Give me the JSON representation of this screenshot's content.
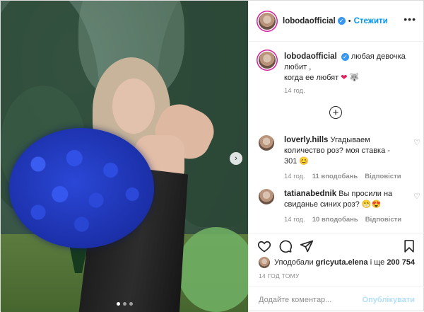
{
  "post": {
    "author": "lobodaofficial",
    "verified": true,
    "follow_label": "Стежити",
    "more_icon": "more-dots-icon"
  },
  "caption": {
    "username": "lobodaofficial",
    "line1": "любая девочка",
    "line2": "любит ,",
    "line3": "когда ее любят",
    "emoji_heart": "❤",
    "emoji_wolf": "🐺",
    "time": "14 год."
  },
  "comments": [
    {
      "username": "loverly.hills",
      "text": "Угадываем количество роз? моя ставка - 301",
      "emoji": "😊",
      "time": "14 год.",
      "likes": "11 вподобань",
      "reply": "Відповісти"
    },
    {
      "username": "tatianabednik",
      "text": "Вы просили на свиданье синих роз?",
      "emoji": "😁😍",
      "time": "14 год.",
      "likes": "10 вподобань",
      "reply": "Відповісти"
    }
  ],
  "likes": {
    "prefix": "Уподобали",
    "user": "gricyuta.elena",
    "middle": "і ще",
    "count": "200 754"
  },
  "post_time": "14 ГОД ТОМУ",
  "add_comment": {
    "placeholder": "Додайте коментар...",
    "publish_label": "Опублікувати"
  },
  "carousel": {
    "next_glyph": "›",
    "dots": 3,
    "active_dot": 1
  },
  "colors": {
    "accent": "#0095f6",
    "verified": "#3897f0",
    "publish_disabled": "#b2dffc",
    "meta_gray": "#8e8e8e"
  }
}
